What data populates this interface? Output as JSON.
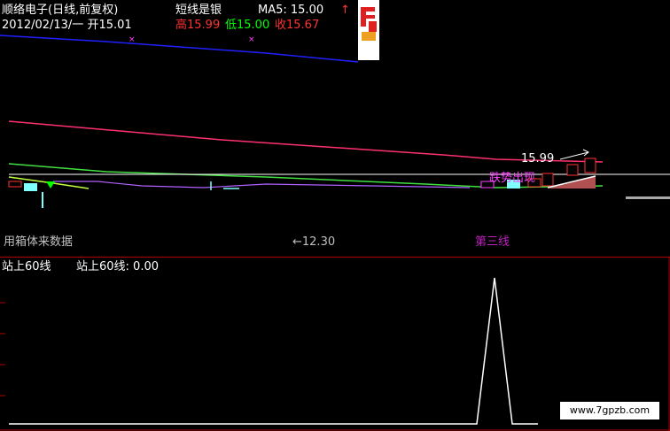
{
  "header": {
    "stock_name": "顺络电子(日线,前复权)",
    "indicator_name": "短线是银",
    "ma5_label": "MA5: 15.00",
    "ma5_arrow": "↑",
    "date_open": "2012/02/13/一  开15.01",
    "high": "高15.99",
    "low": "低15.00",
    "close": "收15.67"
  },
  "main_chart": {
    "peak_label": "15.99",
    "bottom_left_text": "用箱体来数据",
    "bottom_mid_text": "←12.30",
    "bottom_right_text": "第三线",
    "overlay_text": "跌势出现"
  },
  "sub_chart": {
    "title": "站上60线",
    "value_label": "站上60线: 0.00"
  },
  "watermark": "www.7gpzb.com",
  "colors": {
    "yellow": "#ffff00",
    "white": "#ffffff",
    "red": "#ff3232",
    "green": "#00ff00",
    "blue": "#2020ff",
    "magenta": "#ff40ff",
    "cyan": "#80ffff",
    "divider": "#b00000"
  }
}
